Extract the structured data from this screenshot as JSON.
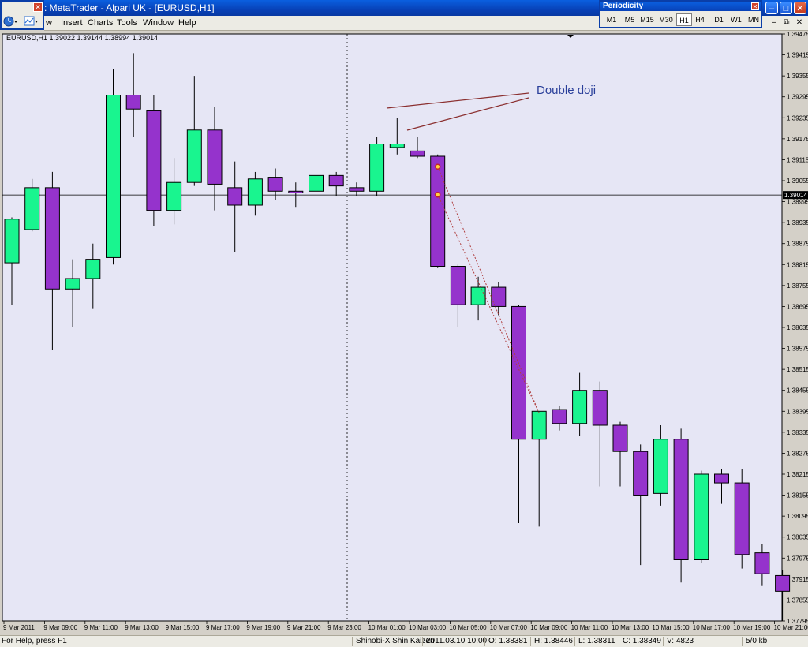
{
  "window": {
    "title": ": MetaTrader - Alpari UK - [EURUSD,H1]"
  },
  "menu": [
    "w",
    "Insert",
    "Charts",
    "Tools",
    "Window",
    "Help"
  ],
  "periodicity": {
    "title": "Periodicity",
    "buttons": [
      "M1",
      "M5",
      "M15",
      "M30",
      "H1",
      "H4",
      "D1",
      "W1",
      "MN"
    ],
    "active": "H1"
  },
  "chart": {
    "info": "EURUSD,H1  1.39022 1.39144 1.38994 1.39014",
    "current_price_label": "1.39014",
    "annotation": "Double doji",
    "colors": {
      "bull": "#19f58f",
      "bear": "#9533cc",
      "background": "#e6e6f5",
      "wick": "#000000",
      "annotation": "#2a3f9a",
      "dotted_line": "#b04040"
    }
  },
  "status": {
    "help": "For Help, press F1",
    "profile": "Shinobi-X Shin Kaizen",
    "datetime": "2011.03.10 10:00",
    "open": "O: 1.38381",
    "high": "H: 1.38446",
    "low": "L: 1.38311",
    "close": "C: 1.38349",
    "volume": "V: 4823",
    "traffic": "5/0 kb"
  },
  "chart_data": {
    "type": "candlestick",
    "symbol": "EURUSD",
    "timeframe": "H1",
    "ylim": [
      1.37795,
      1.39475
    ],
    "y_ticks": [
      "1.39475",
      "1.39415",
      "1.39355",
      "1.39295",
      "1.39235",
      "1.39175",
      "1.39115",
      "1.39055",
      "1.38995",
      "1.38935",
      "1.38875",
      "1.38815",
      "1.38755",
      "1.38695",
      "1.38635",
      "1.38575",
      "1.38515",
      "1.38455",
      "1.38395",
      "1.38335",
      "1.38275",
      "1.38215",
      "1.38155",
      "1.38095",
      "1.38035",
      "1.37975",
      "1.37915",
      "1.37855",
      "1.37795"
    ],
    "x_labels": [
      {
        "i": 0,
        "label": "9 Mar 2011"
      },
      {
        "i": 2,
        "label": "9 Mar 09:00"
      },
      {
        "i": 4,
        "label": "9 Mar 11:00"
      },
      {
        "i": 6,
        "label": "9 Mar 13:00"
      },
      {
        "i": 8,
        "label": "9 Mar 15:00"
      },
      {
        "i": 10,
        "label": "9 Mar 17:00"
      },
      {
        "i": 12,
        "label": "9 Mar 19:00"
      },
      {
        "i": 14,
        "label": "9 Mar 21:00"
      },
      {
        "i": 16,
        "label": "9 Mar 23:00"
      },
      {
        "i": 18,
        "label": "10 Mar 01:00"
      },
      {
        "i": 20,
        "label": "10 Mar 03:00"
      },
      {
        "i": 22,
        "label": "10 Mar 05:00"
      },
      {
        "i": 24,
        "label": "10 Mar 07:00"
      },
      {
        "i": 26,
        "label": "10 Mar 09:00"
      },
      {
        "i": 28,
        "label": "10 Mar 11:00"
      },
      {
        "i": 30,
        "label": "10 Mar 13:00"
      },
      {
        "i": 32,
        "label": "10 Mar 15:00"
      },
      {
        "i": 34,
        "label": "10 Mar 17:00"
      },
      {
        "i": 36,
        "label": "10 Mar 19:00"
      },
      {
        "i": 38,
        "label": "10 Mar 21:00"
      }
    ],
    "candles": [
      {
        "o": 1.3882,
        "h": 1.3895,
        "l": 1.387,
        "c": 1.38945
      },
      {
        "o": 1.38915,
        "h": 1.3906,
        "l": 1.3891,
        "c": 1.39035
      },
      {
        "o": 1.39035,
        "h": 1.3908,
        "l": 1.3857,
        "c": 1.38745
      },
      {
        "o": 1.38745,
        "h": 1.3883,
        "l": 1.38635,
        "c": 1.38775
      },
      {
        "o": 1.38775,
        "h": 1.38875,
        "l": 1.3869,
        "c": 1.3883
      },
      {
        "o": 1.38835,
        "h": 1.39375,
        "l": 1.38815,
        "c": 1.393
      },
      {
        "o": 1.393,
        "h": 1.3942,
        "l": 1.3918,
        "c": 1.3926
      },
      {
        "o": 1.39255,
        "h": 1.393,
        "l": 1.38925,
        "c": 1.3897
      },
      {
        "o": 1.3897,
        "h": 1.3912,
        "l": 1.3893,
        "c": 1.3905
      },
      {
        "o": 1.3905,
        "h": 1.39355,
        "l": 1.3904,
        "c": 1.392
      },
      {
        "o": 1.392,
        "h": 1.39265,
        "l": 1.3897,
        "c": 1.39045
      },
      {
        "o": 1.39035,
        "h": 1.3911,
        "l": 1.3885,
        "c": 1.38985
      },
      {
        "o": 1.38985,
        "h": 1.3908,
        "l": 1.38955,
        "c": 1.3906
      },
      {
        "o": 1.39065,
        "h": 1.3909,
        "l": 1.39,
        "c": 1.39025
      },
      {
        "o": 1.39025,
        "h": 1.3905,
        "l": 1.3898,
        "c": 1.3902
      },
      {
        "o": 1.39025,
        "h": 1.39085,
        "l": 1.3902,
        "c": 1.3907
      },
      {
        "o": 1.3907,
        "h": 1.3908,
        "l": 1.3901,
        "c": 1.3904
      },
      {
        "o": 1.39035,
        "h": 1.3905,
        "l": 1.3901,
        "c": 1.39025
      },
      {
        "o": 1.39025,
        "h": 1.3918,
        "l": 1.3901,
        "c": 1.3916
      },
      {
        "o": 1.3915,
        "h": 1.39235,
        "l": 1.3913,
        "c": 1.3916
      },
      {
        "o": 1.3914,
        "h": 1.3918,
        "l": 1.3912,
        "c": 1.39125
      },
      {
        "o": 1.39125,
        "h": 1.3913,
        "l": 1.38805,
        "c": 1.3881
      },
      {
        "o": 1.3881,
        "h": 1.38815,
        "l": 1.38635,
        "c": 1.387
      },
      {
        "o": 1.387,
        "h": 1.3878,
        "l": 1.38655,
        "c": 1.3875
      },
      {
        "o": 1.3875,
        "h": 1.38765,
        "l": 1.3867,
        "c": 1.38695
      },
      {
        "o": 1.38695,
        "h": 1.387,
        "l": 1.38075,
        "c": 1.38315
      },
      {
        "o": 1.38315,
        "h": 1.38395,
        "l": 1.38065,
        "c": 1.38395
      },
      {
        "o": 1.384,
        "h": 1.3841,
        "l": 1.3834,
        "c": 1.3836
      },
      {
        "o": 1.3836,
        "h": 1.38505,
        "l": 1.38325,
        "c": 1.38455
      },
      {
        "o": 1.38455,
        "h": 1.3848,
        "l": 1.3818,
        "c": 1.38355
      },
      {
        "o": 1.38355,
        "h": 1.38365,
        "l": 1.3818,
        "c": 1.3828
      },
      {
        "o": 1.3828,
        "h": 1.383,
        "l": 1.37955,
        "c": 1.38155
      },
      {
        "o": 1.3816,
        "h": 1.38355,
        "l": 1.38125,
        "c": 1.38315
      },
      {
        "o": 1.38315,
        "h": 1.38345,
        "l": 1.37905,
        "c": 1.3797
      },
      {
        "o": 1.3797,
        "h": 1.38225,
        "l": 1.3796,
        "c": 1.38215
      },
      {
        "o": 1.38215,
        "h": 1.3823,
        "l": 1.3813,
        "c": 1.3819
      },
      {
        "o": 1.3819,
        "h": 1.3823,
        "l": 1.37945,
        "c": 1.37985
      },
      {
        "o": 1.3799,
        "h": 1.38015,
        "l": 1.37895,
        "c": 1.3793
      },
      {
        "o": 1.37925,
        "h": 1.3794,
        "l": 1.37795,
        "c": 1.3788
      }
    ]
  }
}
